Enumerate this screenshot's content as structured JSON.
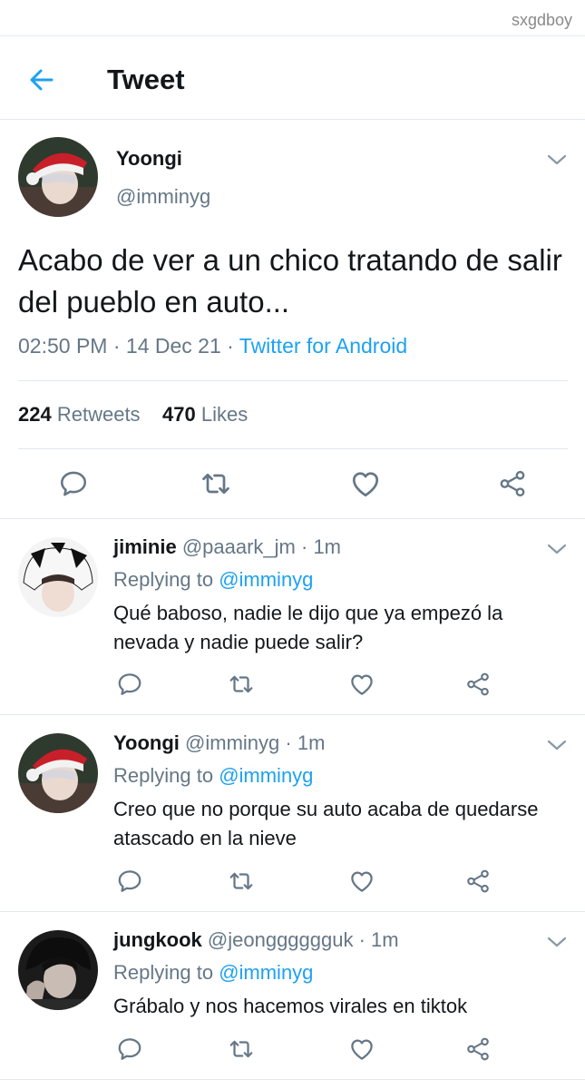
{
  "watermark": "sxgdboy",
  "header": {
    "title": "Tweet",
    "back_icon": "arrow-left-icon"
  },
  "colors": {
    "accent": "#1da1f2",
    "secondary_text": "#657786",
    "primary_text": "#14171a",
    "divider": "#e1e8ed"
  },
  "tweet": {
    "name": "Yoongi",
    "handle": "@imminyg",
    "text": "Acabo de ver a un chico tratando de salir del pueblo en auto...",
    "time": "02:50 PM",
    "sep1": " · ",
    "date": "14 Dec 21",
    "sep2": " · ",
    "source": "Twitter for Android",
    "retweets_count": "224",
    "retweets_label": "Retweets",
    "likes_count": "470",
    "likes_label": "Likes"
  },
  "replies": [
    {
      "name": "jiminie",
      "handle": "@paaark_jm",
      "sep": " · ",
      "time": "1m",
      "replying_label": "Replying to ",
      "replying_to": "@imminyg",
      "text": "Qué baboso, nadie le dijo que ya empezó la nevada y nadie puede salir?"
    },
    {
      "name": "Yoongi",
      "handle": "@imminyg",
      "sep": " · ",
      "time": "1m",
      "replying_label": "Replying to ",
      "replying_to": "@imminyg",
      "text": "Creo que no porque su auto acaba de quedarse atascado en la nieve"
    },
    {
      "name": "jungkook",
      "handle": "@jeongggggguk",
      "sep": " · ",
      "time": "1m",
      "replying_label": "Replying to ",
      "replying_to": "@imminyg",
      "text": "Grábalo y nos hacemos virales en tiktok"
    }
  ],
  "action_icons": [
    "reply-icon",
    "retweet-icon",
    "like-icon",
    "share-icon"
  ]
}
